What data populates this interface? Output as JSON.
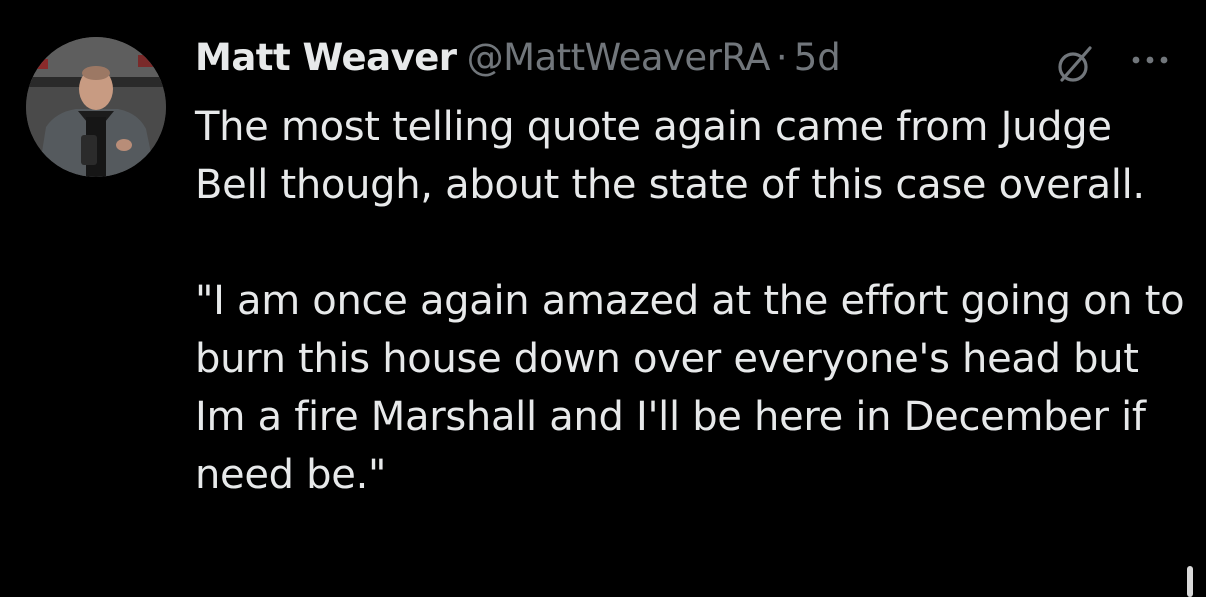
{
  "tweet": {
    "author_name": "Matt Weaver",
    "author_handle": "@MattWeaverRA",
    "separator": "·",
    "timestamp": "5d",
    "paragraphs": [
      "The most telling quote again came from Judge Bell though, about the state of this case overall.",
      "\"I am once again amazed at the effort going on to burn this house down over everyone's head but Im a fire Marshall and I'll be here in December if need be.\""
    ]
  },
  "icons": {
    "grok": "grok-icon",
    "more": "more-options-icon"
  },
  "colors": {
    "background": "#000000",
    "primary_text": "#e7e9ea",
    "secondary_text": "#71767b"
  }
}
